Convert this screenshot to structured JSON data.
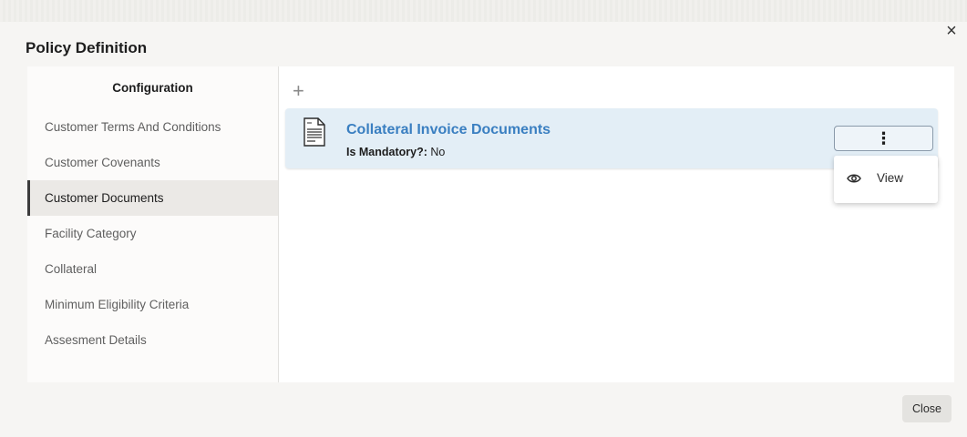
{
  "dialog": {
    "title": "Policy Definition",
    "close_icon": "×"
  },
  "sidebar": {
    "header": "Configuration",
    "items": [
      {
        "label": "Customer Terms And Conditions",
        "active": false
      },
      {
        "label": "Customer Covenants",
        "active": false
      },
      {
        "label": "Customer Documents",
        "active": true
      },
      {
        "label": "Facility Category",
        "active": false
      },
      {
        "label": "Collateral",
        "active": false
      },
      {
        "label": "Minimum Eligibility Criteria",
        "active": false
      },
      {
        "label": "Assesment Details",
        "active": false
      }
    ]
  },
  "content": {
    "add_icon": "+",
    "card": {
      "title": "Collateral Invoice Documents",
      "field_label": "Is Mandatory?:",
      "field_value": "No",
      "icon": "document-icon",
      "actions_icon": "⋮"
    },
    "menu": {
      "items": [
        {
          "label": "View",
          "icon": "eye-icon"
        }
      ]
    }
  },
  "footer": {
    "close_label": "Close"
  },
  "colors": {
    "accent_link": "#3a7fc1",
    "card_bg": "#e3eef6",
    "active_item_bg": "#ebe9e6"
  }
}
